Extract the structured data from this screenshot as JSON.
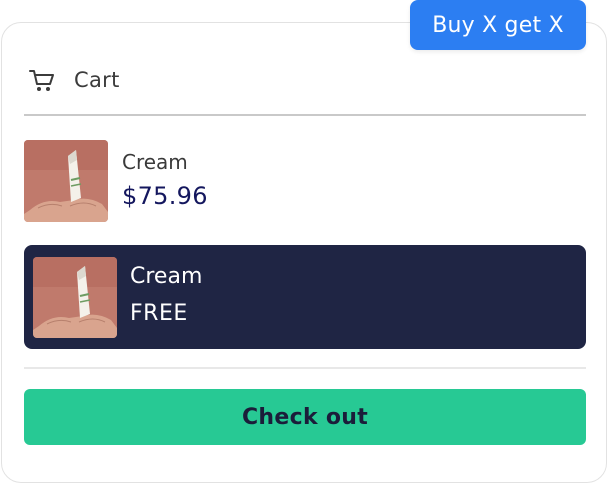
{
  "badge": {
    "label": "Buy X get X",
    "color": "#2c7ef2"
  },
  "cart": {
    "title": "Cart",
    "icon": "cart-icon"
  },
  "items": [
    {
      "name": "Cream",
      "price": "$75.96",
      "thumbnail": "cream-tube-in-hands"
    },
    {
      "name": "Cream",
      "price": "FREE",
      "thumbnail": "cream-tube-in-hands"
    }
  ],
  "checkout": {
    "label": "Check out",
    "color": "#27c994"
  },
  "colors": {
    "free_row_bg": "#1f2544",
    "price_text": "#14175e",
    "thumbnail_bg": "#c07a6c"
  }
}
